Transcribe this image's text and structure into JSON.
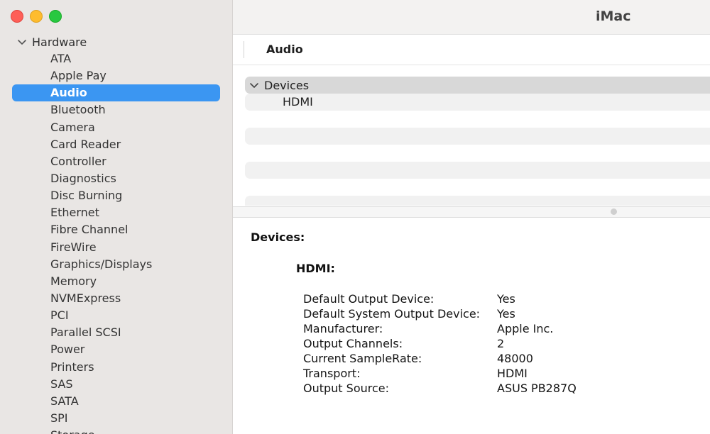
{
  "window": {
    "title": "iMac"
  },
  "sidebar": {
    "section": "Hardware",
    "items": [
      "ATA",
      "Apple Pay",
      "Audio",
      "Bluetooth",
      "Camera",
      "Card Reader",
      "Controller",
      "Diagnostics",
      "Disc Burning",
      "Ethernet",
      "Fibre Channel",
      "FireWire",
      "Graphics/Displays",
      "Memory",
      "NVMExpress",
      "PCI",
      "Parallel SCSI",
      "Power",
      "Printers",
      "SAS",
      "SATA",
      "SPI",
      "Storage"
    ],
    "selected": "Audio"
  },
  "main": {
    "column_header": "Audio",
    "list": {
      "group": "Devices",
      "child": "HDMI"
    }
  },
  "detail": {
    "heading": "Devices:",
    "device": "HDMI:",
    "properties": [
      {
        "key": "Default Output Device:",
        "value": "Yes"
      },
      {
        "key": "Default System Output Device:",
        "value": "Yes"
      },
      {
        "key": "Manufacturer:",
        "value": "Apple Inc."
      },
      {
        "key": "Output Channels:",
        "value": "2"
      },
      {
        "key": "Current SampleRate:",
        "value": "48000"
      },
      {
        "key": "Transport:",
        "value": "HDMI"
      },
      {
        "key": "Output Source:",
        "value": "ASUS PB287Q"
      }
    ]
  },
  "colors": {
    "accent": "#3b96f2",
    "sidebar_bg": "#e9e6e4"
  }
}
